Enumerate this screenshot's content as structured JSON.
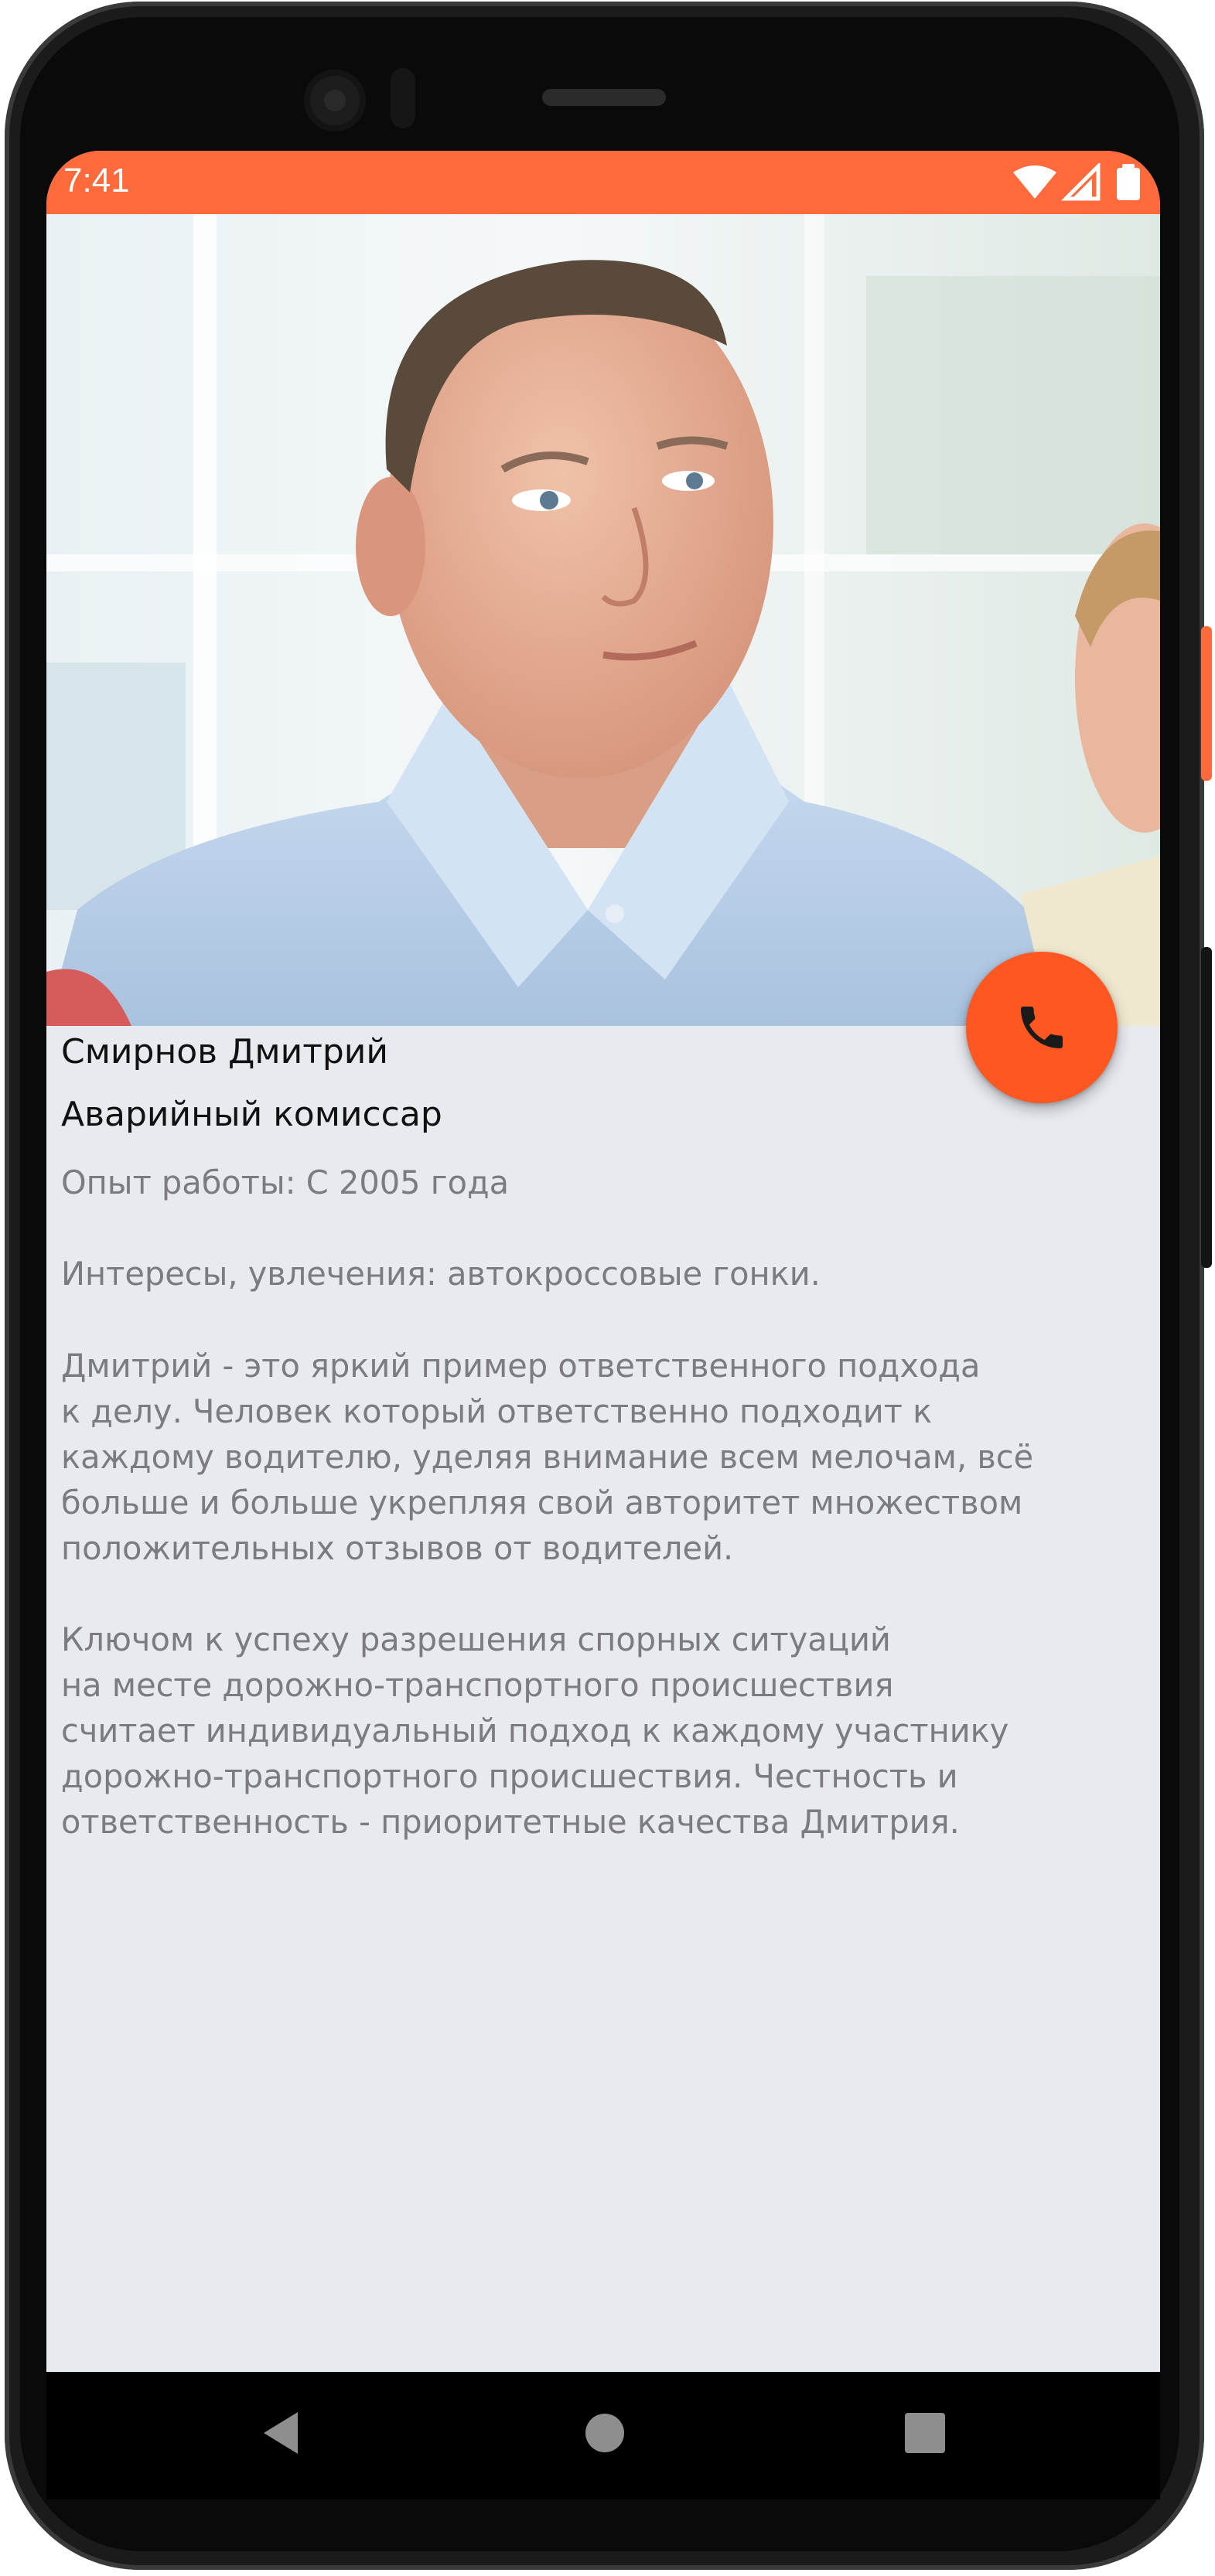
{
  "status_bar": {
    "time": "7:41",
    "accent_color": "#ff6a3d",
    "icons": [
      "wifi-icon",
      "cell-signal-icon",
      "battery-icon"
    ]
  },
  "profile": {
    "photo": "man-in-light-blue-shirt-photo",
    "name": "Смирнов Дмитрий",
    "role": "Аварийный комиссар",
    "experience": "Опыт работы: С 2005 года",
    "interests": "Интересы, увлечения: автокроссовые гонки.",
    "bio_paragraph_1": "Дмитрий - это яркий пример ответственного подхода\nк делу. Человек который ответственно подходит к\nкаждому водителю, уделяя внимание всем мелочам, всё\nбольше и больше укрепляя свой авторитет множеством\nположительных отзывов от водителей.",
    "bio_paragraph_2": "Ключом к успеху разрешения спорных ситуаций\nна месте дорожно-транспортного происшествия\nсчитает индивидуальный подход к каждому участнику\nдорожно-транспортного происшествия. Честность и\nответственность - приоритетные качества Дмитрия."
  },
  "call_button": {
    "icon": "phone-icon",
    "color": "#ff5722"
  },
  "navigation": {
    "buttons": [
      "back-icon",
      "home-icon",
      "recents-icon"
    ]
  },
  "colors": {
    "screen_background": "#e7eaef",
    "primary_text": "#111111",
    "secondary_text": "#7b7b80"
  }
}
